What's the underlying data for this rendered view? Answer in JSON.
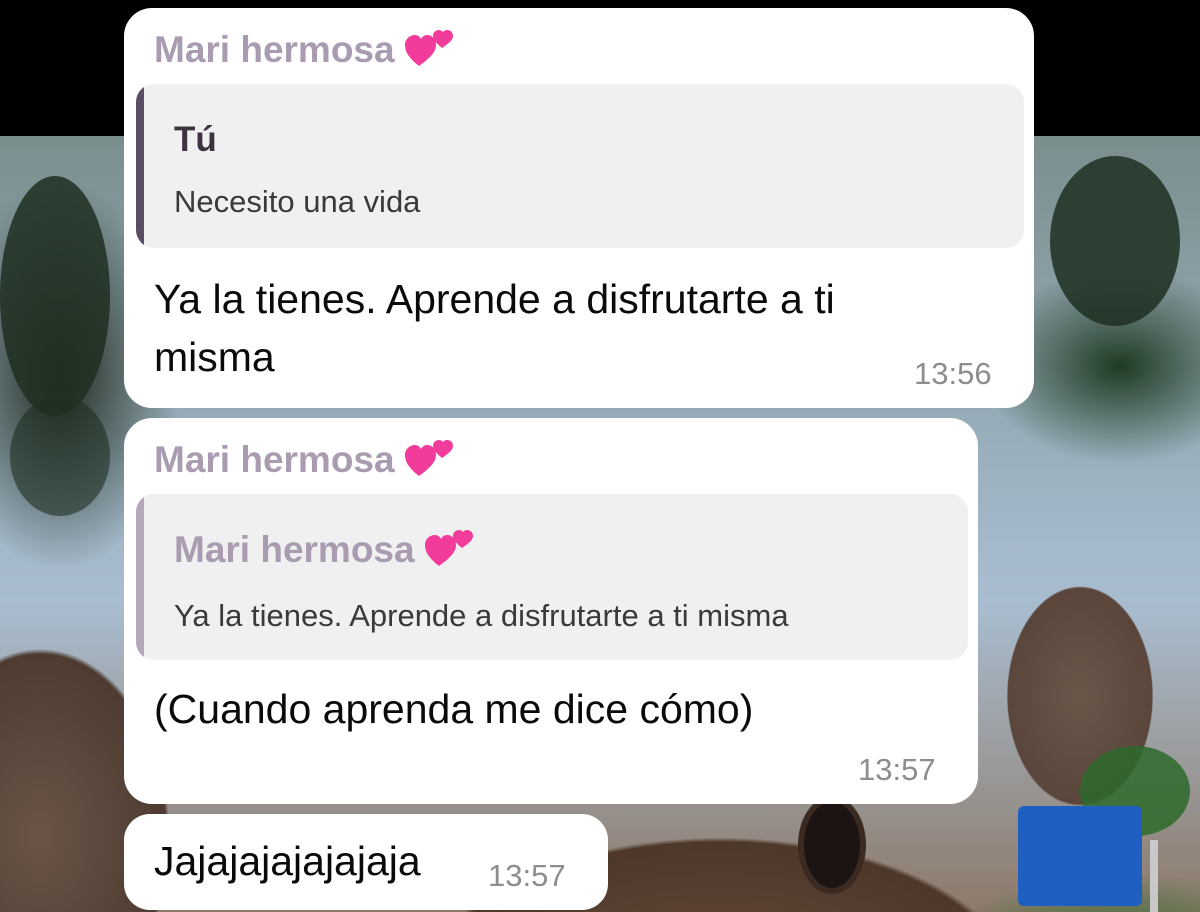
{
  "messages": [
    {
      "sender": "Mari hermosa",
      "sender_icon": "two-hearts-icon",
      "quote": {
        "name": "Tú",
        "text": "Necesito una vida"
      },
      "text": "Ya la tienes. Aprende a disfrutarte a ti misma",
      "time": "13:56"
    },
    {
      "sender": "Mari hermosa",
      "sender_icon": "two-hearts-icon",
      "quote": {
        "name": "Mari hermosa",
        "name_icon": "two-hearts-icon",
        "text": "Ya la tienes. Aprende a disfrutarte a ti misma"
      },
      "text": "(Cuando aprenda me dice cómo)",
      "time": "13:57"
    },
    {
      "text": "Jajajajajajajaja",
      "time": "13:57"
    }
  ],
  "colors": {
    "sender_name": "#a99bb0",
    "quote_bar_own": "#5b4d63",
    "quote_bar_contact": "#b3a7b8",
    "quote_background": "#f0f0f0",
    "bubble_background": "#ffffff",
    "heart": "#f23c9c"
  }
}
